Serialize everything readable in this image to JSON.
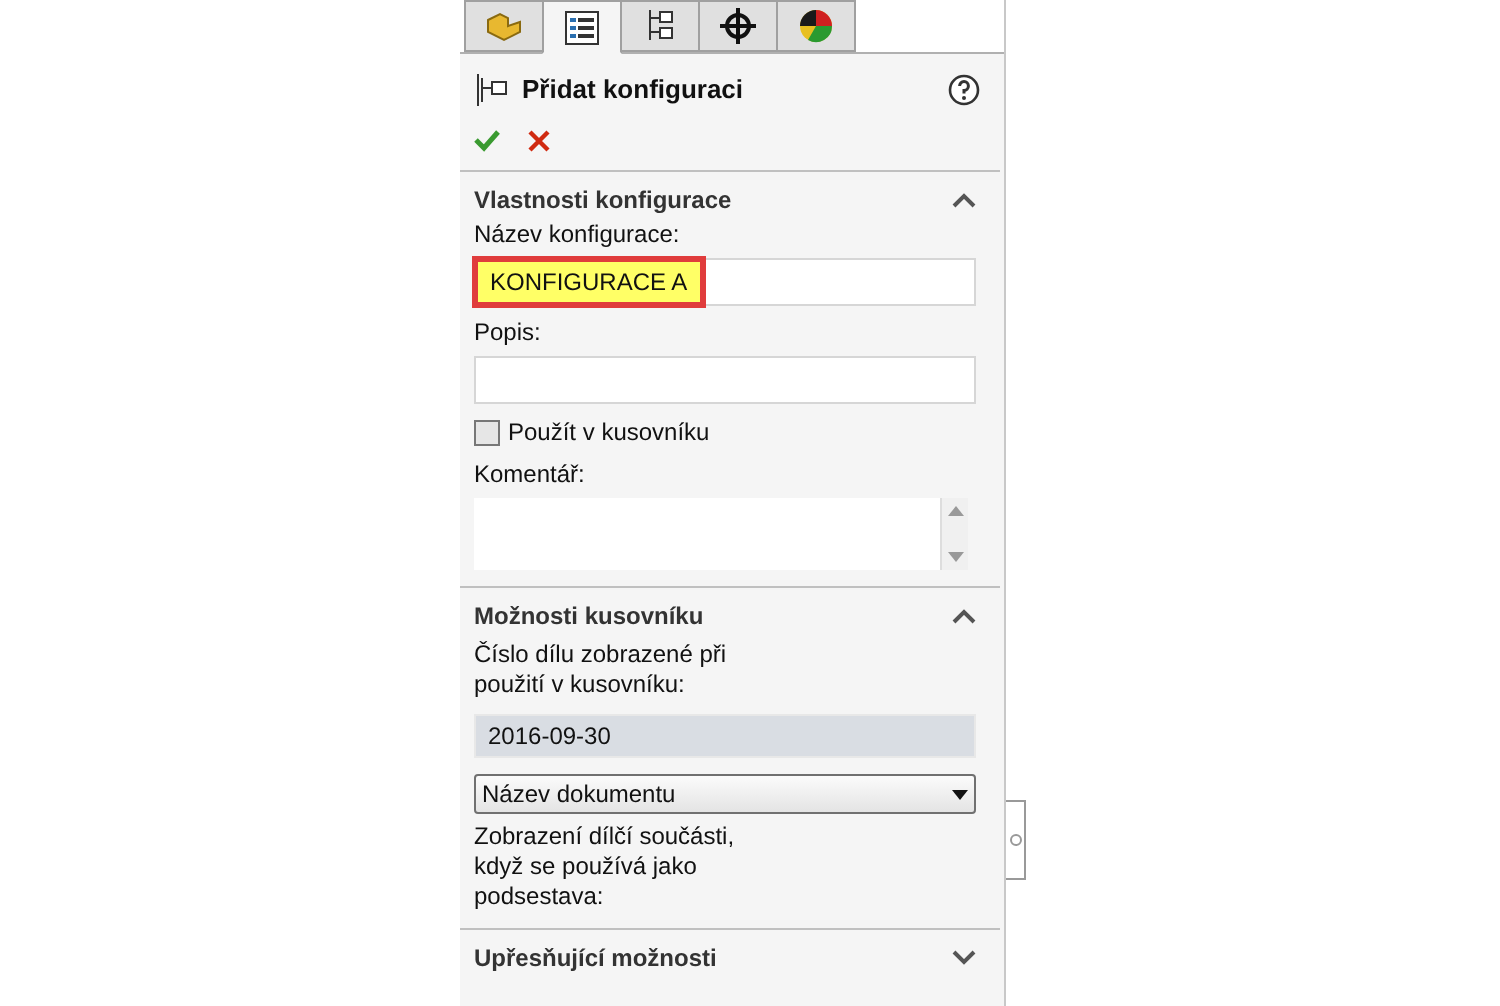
{
  "tabs": [
    {
      "kind": "part",
      "selected": false
    },
    {
      "kind": "list",
      "selected": true
    },
    {
      "kind": "tree",
      "selected": false
    },
    {
      "kind": "target",
      "selected": false
    },
    {
      "kind": "appearance",
      "selected": false
    }
  ],
  "panel": {
    "title": "Přidat konfiguraci"
  },
  "sections": [
    {
      "kind": "properties",
      "title": "Vlastnosti konfigurace",
      "expanded": true,
      "name_label": "Název konfigurace:",
      "name_value": "KONFIGURACE A",
      "description_label": "Popis:",
      "use_in_bom": {
        "label": "Použít v kusovníku",
        "checked": false
      },
      "comment_label": "Komentář:"
    },
    {
      "kind": "bom",
      "title": "Možnosti kusovníku",
      "expanded": true,
      "part_number_label": "Číslo dílu zobrazené při použití v kusovníku:",
      "part_number_value": "2016-09-30",
      "source": "Název dokumentu",
      "child_label": "Zobrazení dílčí součásti, když se používá jako podsestava:"
    },
    {
      "title": "Upřesňující možnosti",
      "expanded": false
    }
  ]
}
